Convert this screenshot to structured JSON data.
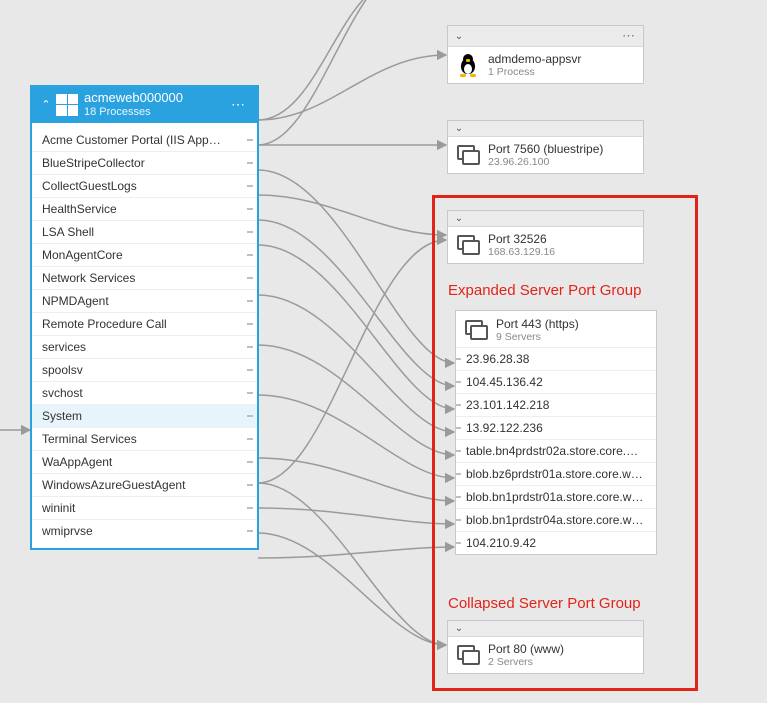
{
  "source": {
    "title": "acmeweb000000",
    "subtitle": "18 Processes",
    "processes": [
      "Acme Customer Portal (IIS App…",
      "BlueStripeCollector",
      "CollectGuestLogs",
      "HealthService",
      "LSA Shell",
      "MonAgentCore",
      "Network Services",
      "NPMDAgent",
      "Remote Procedure Call",
      "services",
      "spoolsv",
      "svchost",
      "System",
      "Terminal Services",
      "WaAppAgent",
      "WindowsAzureGuestAgent",
      "wininit",
      "wmiprvse"
    ],
    "selected_index": 12
  },
  "cards": {
    "linux": {
      "title": "admdemo-appsvr",
      "subtitle": "1 Process"
    },
    "port7560": {
      "title": "Port 7560 (bluestripe)",
      "subtitle": "23.96.26.100"
    },
    "port32526": {
      "title": "Port 32526",
      "subtitle": "168.63.129.16"
    },
    "port80": {
      "title": "Port 80 (www)",
      "subtitle": "2 Servers"
    }
  },
  "port443": {
    "title": "Port 443 (https)",
    "subtitle": "9 Servers",
    "servers": [
      "23.96.28.38",
      "104.45.136.42",
      "23.101.142.218",
      "13.92.122.236",
      "table.bn4prdstr02a.store.core.…",
      "blob.bz6prdstr01a.store.core.w…",
      "blob.bn1prdstr01a.store.core.w…",
      "blob.bn1prdstr04a.store.core.w…",
      "104.210.9.42"
    ]
  },
  "annotations": {
    "expanded_label": "Expanded Server Port Group",
    "collapsed_label": "Collapsed Server Port Group"
  }
}
